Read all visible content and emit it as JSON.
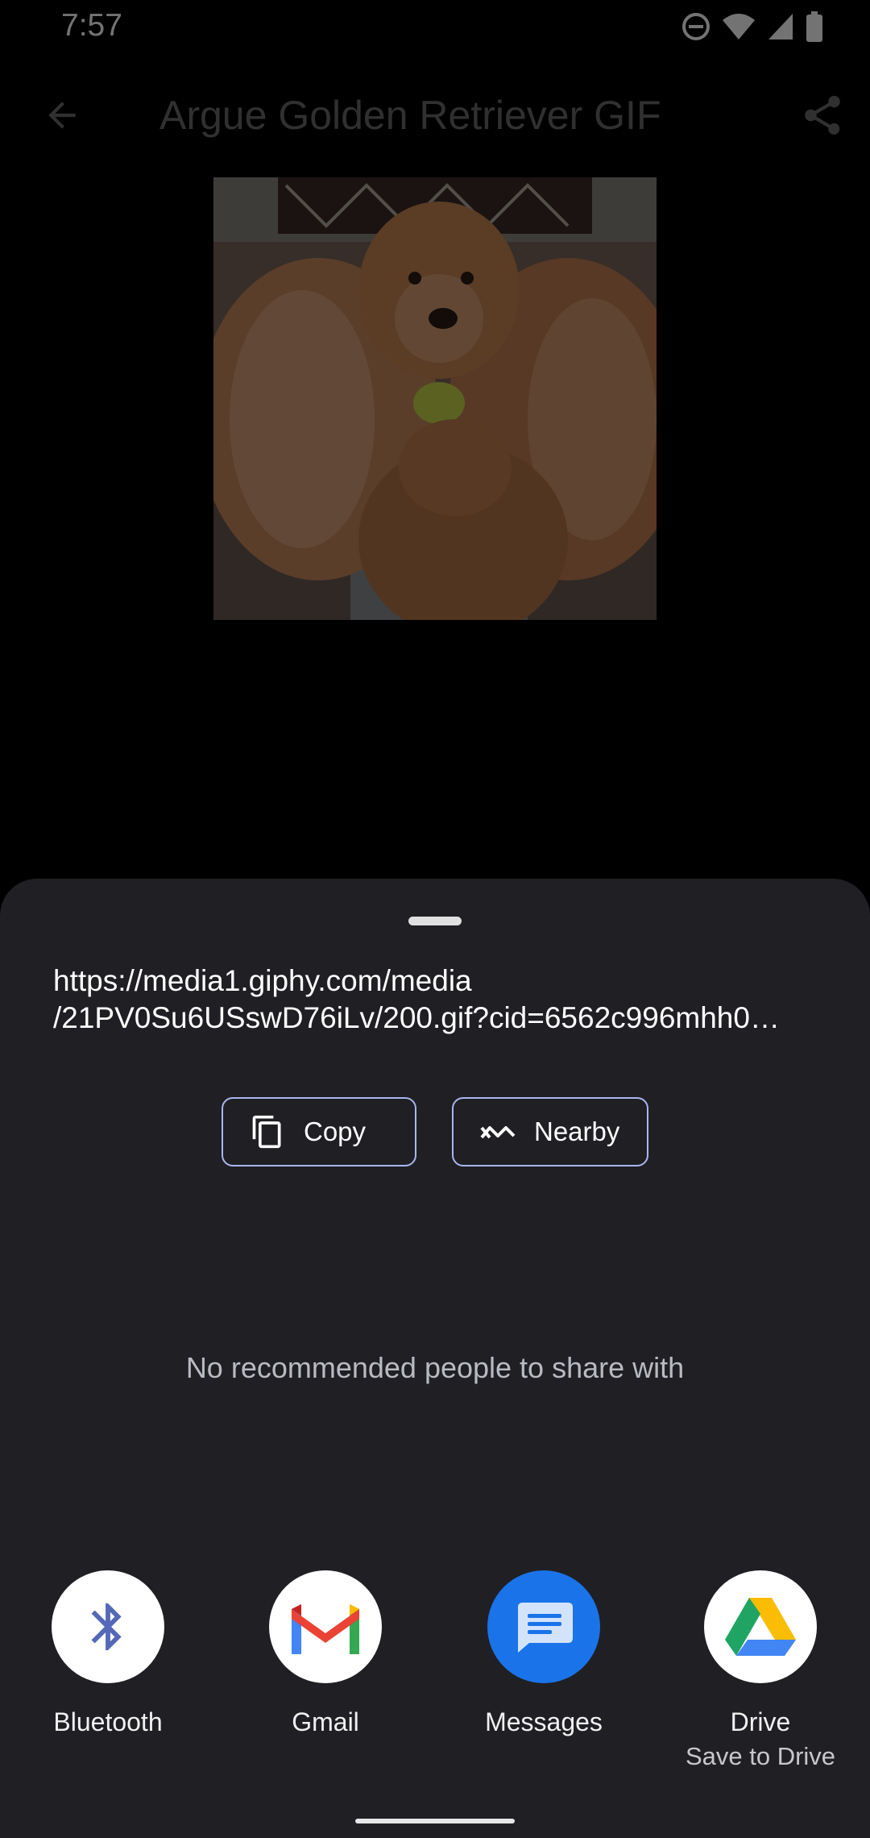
{
  "status_bar": {
    "time": "7:57",
    "icons": [
      "do-not-disturb-icon",
      "wifi-icon",
      "signal-icon",
      "battery-icon"
    ]
  },
  "app_bar": {
    "title": "Argue Golden Retriever GIF",
    "back_icon": "back-arrow-icon",
    "share_icon": "share-icon"
  },
  "preview": {
    "description_icon": "gif-image"
  },
  "share_sheet": {
    "url_line_1": "https://media1.giphy.com/media",
    "url_line_2": "/21PV0Su6USswD76iLv/200.gif?cid=6562c996mhh0…",
    "copy_label": "Copy",
    "nearby_label": "Nearby",
    "empty_people_text": "No recommended people to share with",
    "targets": [
      {
        "label": "Bluetooth",
        "sublabel": "",
        "icon": "bluetooth-icon"
      },
      {
        "label": "Gmail",
        "sublabel": "",
        "icon": "gmail-icon"
      },
      {
        "label": "Messages",
        "sublabel": "",
        "icon": "messages-icon"
      },
      {
        "label": "Drive",
        "sublabel": "Save to Drive",
        "icon": "drive-icon"
      }
    ]
  },
  "colors": {
    "sheet_bg": "#1f1f24",
    "chip_border": "#a9b6ee",
    "messages_blue": "#1a73e8",
    "bluetooth_blue": "#5568b8"
  }
}
